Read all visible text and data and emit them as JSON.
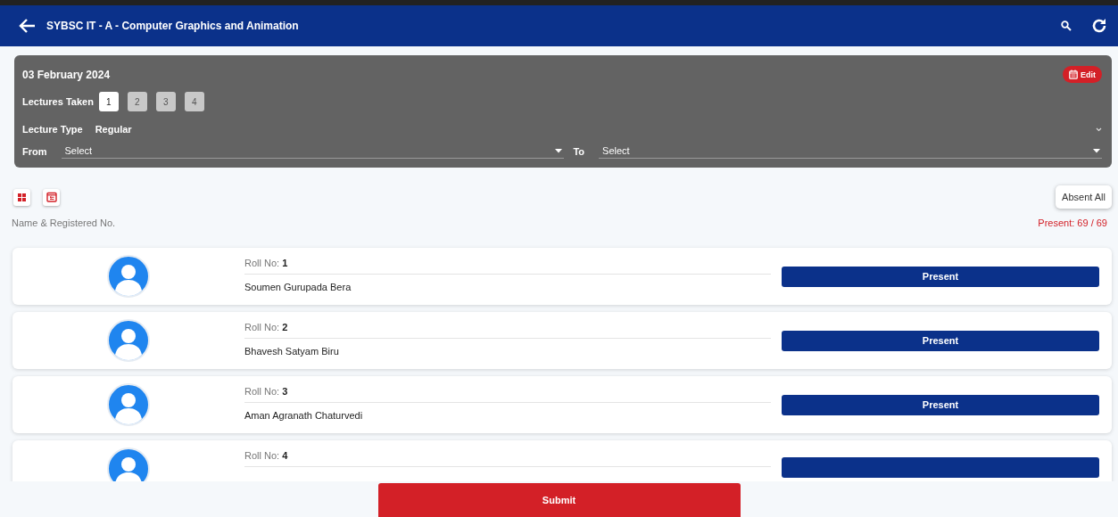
{
  "header": {
    "title": "SYBSC IT - A - Computer Graphics and Animation"
  },
  "panel": {
    "date": "03 February 2024",
    "edit_label": "Edit",
    "lectures_label": "Lectures Taken",
    "lectures": [
      {
        "label": "1",
        "selected": true
      },
      {
        "label": "2",
        "selected": false
      },
      {
        "label": "3",
        "selected": false
      },
      {
        "label": "4",
        "selected": false
      }
    ],
    "lecture_type_label": "Lecture Type",
    "lecture_type": "Regular",
    "from_label": "From",
    "from_value": "Select",
    "to_label": "To",
    "to_value": "Select"
  },
  "toolbar": {
    "absent_all": "Absent All"
  },
  "list_header": {
    "column_label": "Name & Registered No.",
    "present_count": "Present: 69 / 69"
  },
  "students": [
    {
      "roll": "Roll No: **1**",
      "name": "Soumen Gurupada Bera",
      "present": true,
      "button": "Present"
    },
    {
      "roll": "Roll No: **2**",
      "name": "Bhavesh Satyam Biru",
      "present": true,
      "button": "Present"
    },
    {
      "roll": "Roll No: **3**",
      "name": "Aman Agranath Chaturvedi",
      "present": true,
      "button": "Present"
    },
    {
      "roll": "Roll No: **4**",
      "present": true
    }
  ],
  "submit": "Submit"
}
